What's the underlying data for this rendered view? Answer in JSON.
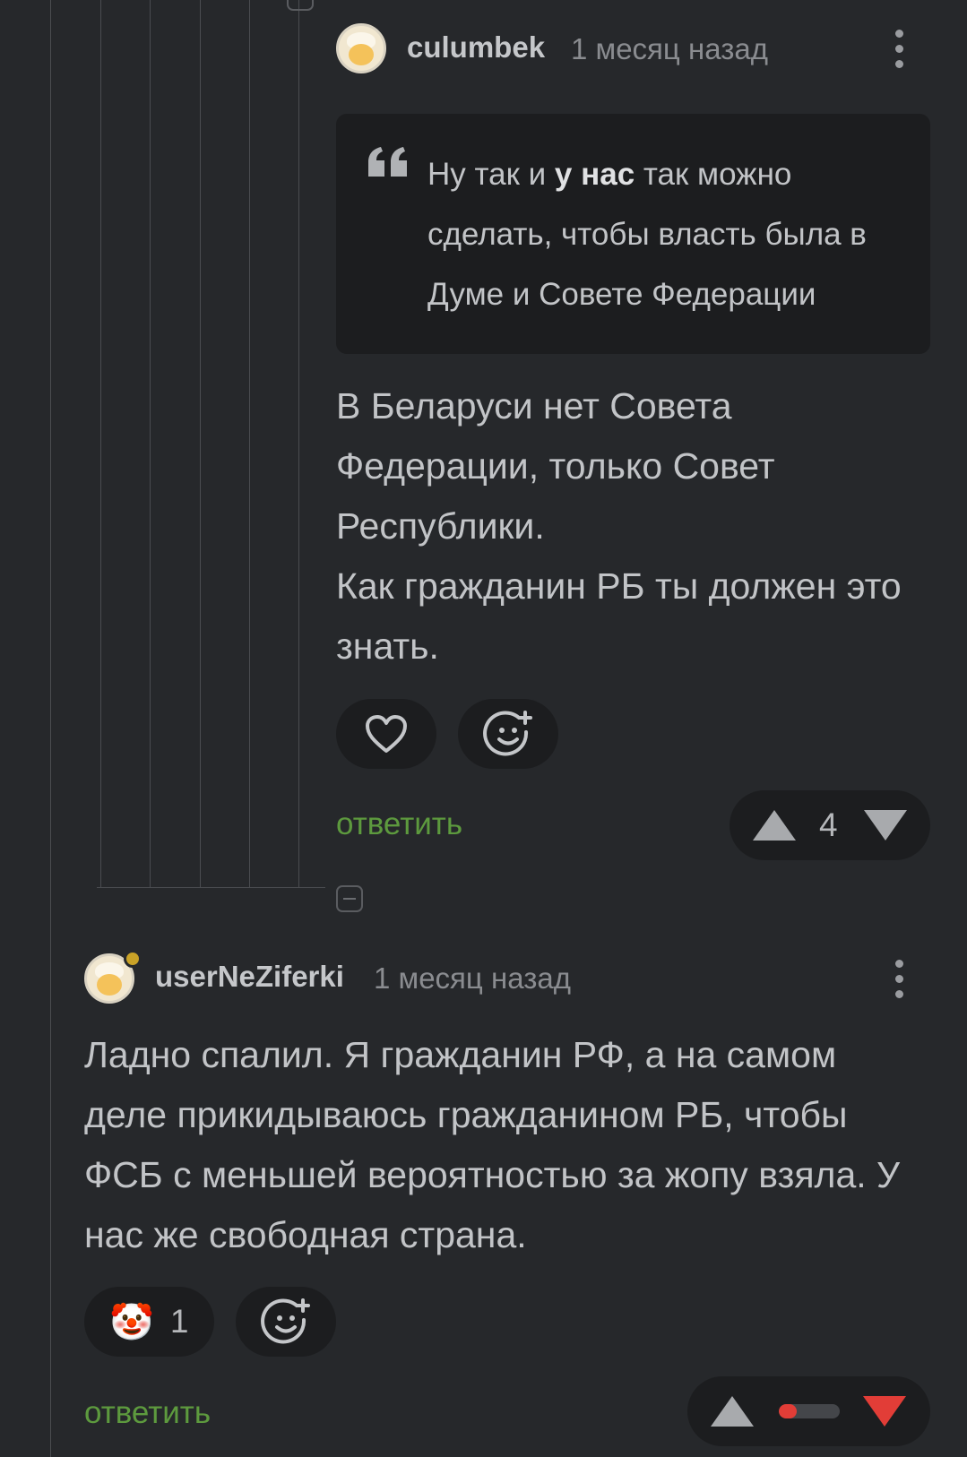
{
  "comments": [
    {
      "author": "culumbek",
      "time": "1 месяц назад",
      "quote": {
        "before": "Ну так и ",
        "bold": "у нас",
        "after": " так можно сделать, чтобы власть была в Думе и Совете Федерации"
      },
      "text": "В Беларуси нет Совета Федерации, только Совет Республики.\nКак гражданин РБ ты должен это знать.",
      "reply_label": "ответить",
      "rating": "4"
    },
    {
      "author": "userNeZiferki",
      "time": "1 месяц назад",
      "text": "Ладно спалил. Я гражданин РФ, а на самом деле прикидываюсь гражданином РБ, чтобы ФСБ с меньшей вероятностью за жопу взяла. У нас же свободная страна.",
      "reaction": {
        "emoji": "🤡",
        "count": "1"
      },
      "reply_label": "ответить",
      "rating_fraction_negative": 0.3
    }
  ],
  "colors": {
    "background": "#26282b",
    "reply": "#5d9a3e",
    "downvote_active": "#e23d37",
    "online": "#c9a227"
  },
  "icons": [
    "heart-icon",
    "add-reaction-icon",
    "upvote-icon",
    "downvote-icon",
    "more-icon",
    "collapse-icon",
    "quote-icon",
    "clown-emoji"
  ]
}
